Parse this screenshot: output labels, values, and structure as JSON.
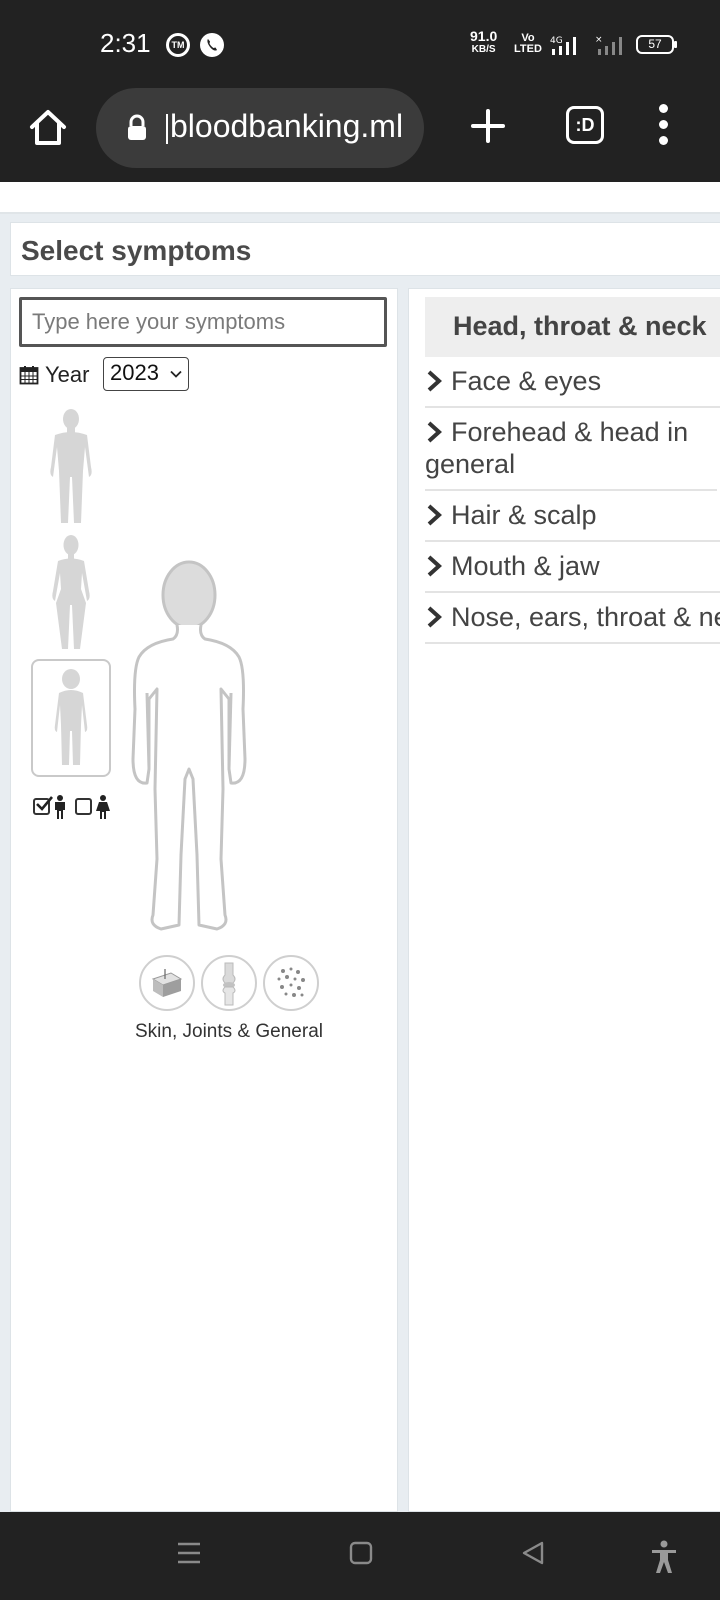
{
  "status_bar": {
    "time": "2:31",
    "tm_icon_text": "TM",
    "net_speed_value": "91.0",
    "net_speed_unit": "KB/S",
    "volte_top": "Vo",
    "volte_bottom": "LTED",
    "network_label": "4G",
    "battery": "57"
  },
  "browser": {
    "url": "bloodbanking.ml",
    "tabs_label": ":D"
  },
  "page": {
    "title": "Select symptoms",
    "search": {
      "placeholder": "Type here your symptoms",
      "value": ""
    },
    "year": {
      "label": "Year",
      "selected": "2023"
    },
    "body_models": [
      "male-adult",
      "female-adult",
      "child"
    ],
    "selected_body_model": "child",
    "gender": {
      "male_checked": true,
      "female_checked": false
    },
    "category_label": "Skin, Joints & General",
    "categories": [
      "skin-icon",
      "joint-icon",
      "general-icon"
    ],
    "region": {
      "title": "Head, throat & neck",
      "items": [
        {
          "label": "Face & eyes"
        },
        {
          "label": "Forehead & head in general"
        },
        {
          "label": "Hair & scalp"
        },
        {
          "label": "Mouth & jaw"
        },
        {
          "label": "Nose, ears, throat & neck"
        }
      ]
    }
  },
  "colors": {
    "system_bar": "#222222",
    "page_bg": "#e8edf1",
    "body_figure": "#d4d4d4",
    "text_dark": "#444444"
  }
}
